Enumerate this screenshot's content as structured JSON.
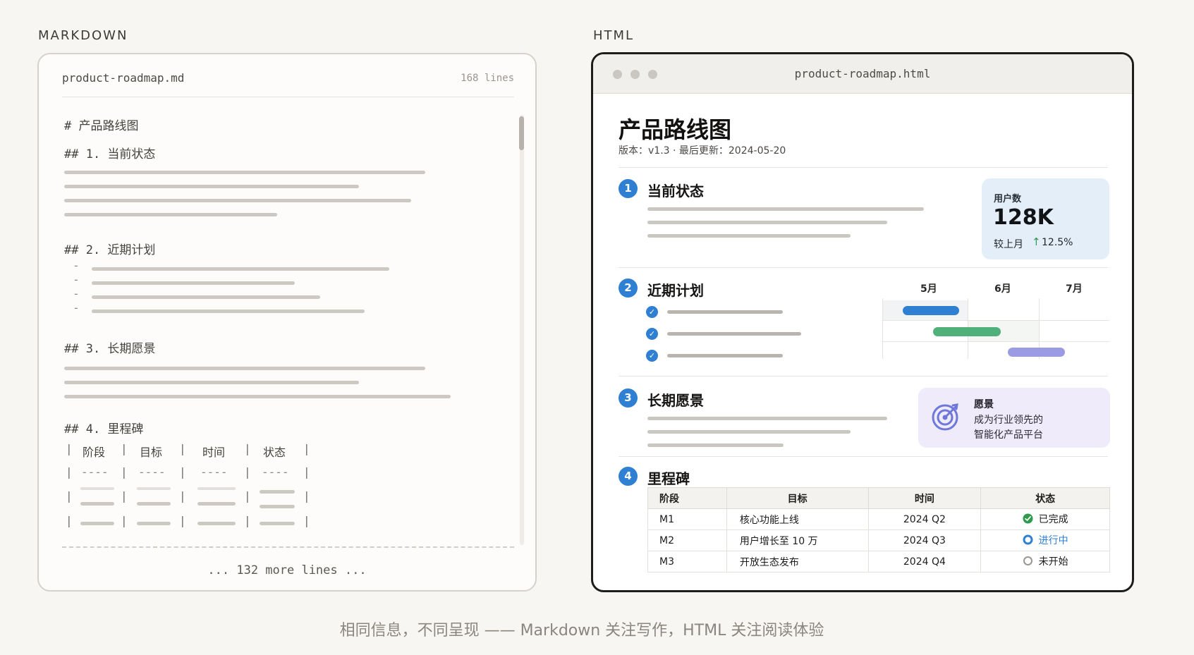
{
  "labels": {
    "markdown": "MARKDOWN",
    "html": "HTML"
  },
  "markdown": {
    "filename": "product-roadmap.md",
    "line_count": "168 lines",
    "h1": "# 产品路线图",
    "h2_1": "## 1. 当前状态",
    "h2_2": "## 2. 近期计划",
    "h2_3": "## 3. 长期愿景",
    "h2_4": "## 4. 里程碑",
    "list_dash": "-",
    "table_header": [
      "阶段",
      "目标",
      "时间",
      "状态"
    ],
    "table_sep": "----",
    "pipe": "|",
    "more": "... 132 more lines ..."
  },
  "html": {
    "window_title": "product-roadmap.html",
    "title": "产品路线图",
    "meta": "版本：v1.3 · 最后更新：2024-05-20",
    "sections": [
      {
        "num": "1",
        "title": "当前状态"
      },
      {
        "num": "2",
        "title": "近期计划"
      },
      {
        "num": "3",
        "title": "长期愿景"
      },
      {
        "num": "4",
        "title": "里程碑"
      }
    ],
    "stat_card": {
      "label": "用户数",
      "value": "128K",
      "sub": "较上月",
      "arrow": "↑",
      "change": "12.5%"
    },
    "gantt": {
      "months": [
        "5月",
        "6月",
        "7月"
      ]
    },
    "vision_card": {
      "title": "愿景",
      "line1": "成为行业领先的",
      "line2": "智能化产品平台"
    },
    "milestones": {
      "headers": [
        "阶段",
        "目标",
        "时间",
        "状态"
      ],
      "rows": [
        {
          "phase": "M1",
          "goal": "核心功能上线",
          "time": "2024 Q2",
          "status": "已完成"
        },
        {
          "phase": "M2",
          "goal": "用户增长至 10 万",
          "time": "2024 Q3",
          "status": "进行中"
        },
        {
          "phase": "M3",
          "goal": "开放生态发布",
          "time": "2024 Q4",
          "status": "未开始"
        }
      ]
    }
  },
  "colors": {
    "accent": "#2f7fd3",
    "bar_blue": "#2f7fd3",
    "bar_green": "#4fb07a",
    "bar_purple": "#9b9be3",
    "success": "#2f9a4e",
    "progress": "#2f7fd3",
    "pending": "#9b978f"
  },
  "caption": "相同信息，不同呈现 —— Markdown 关注写作，HTML 关注阅读体验"
}
